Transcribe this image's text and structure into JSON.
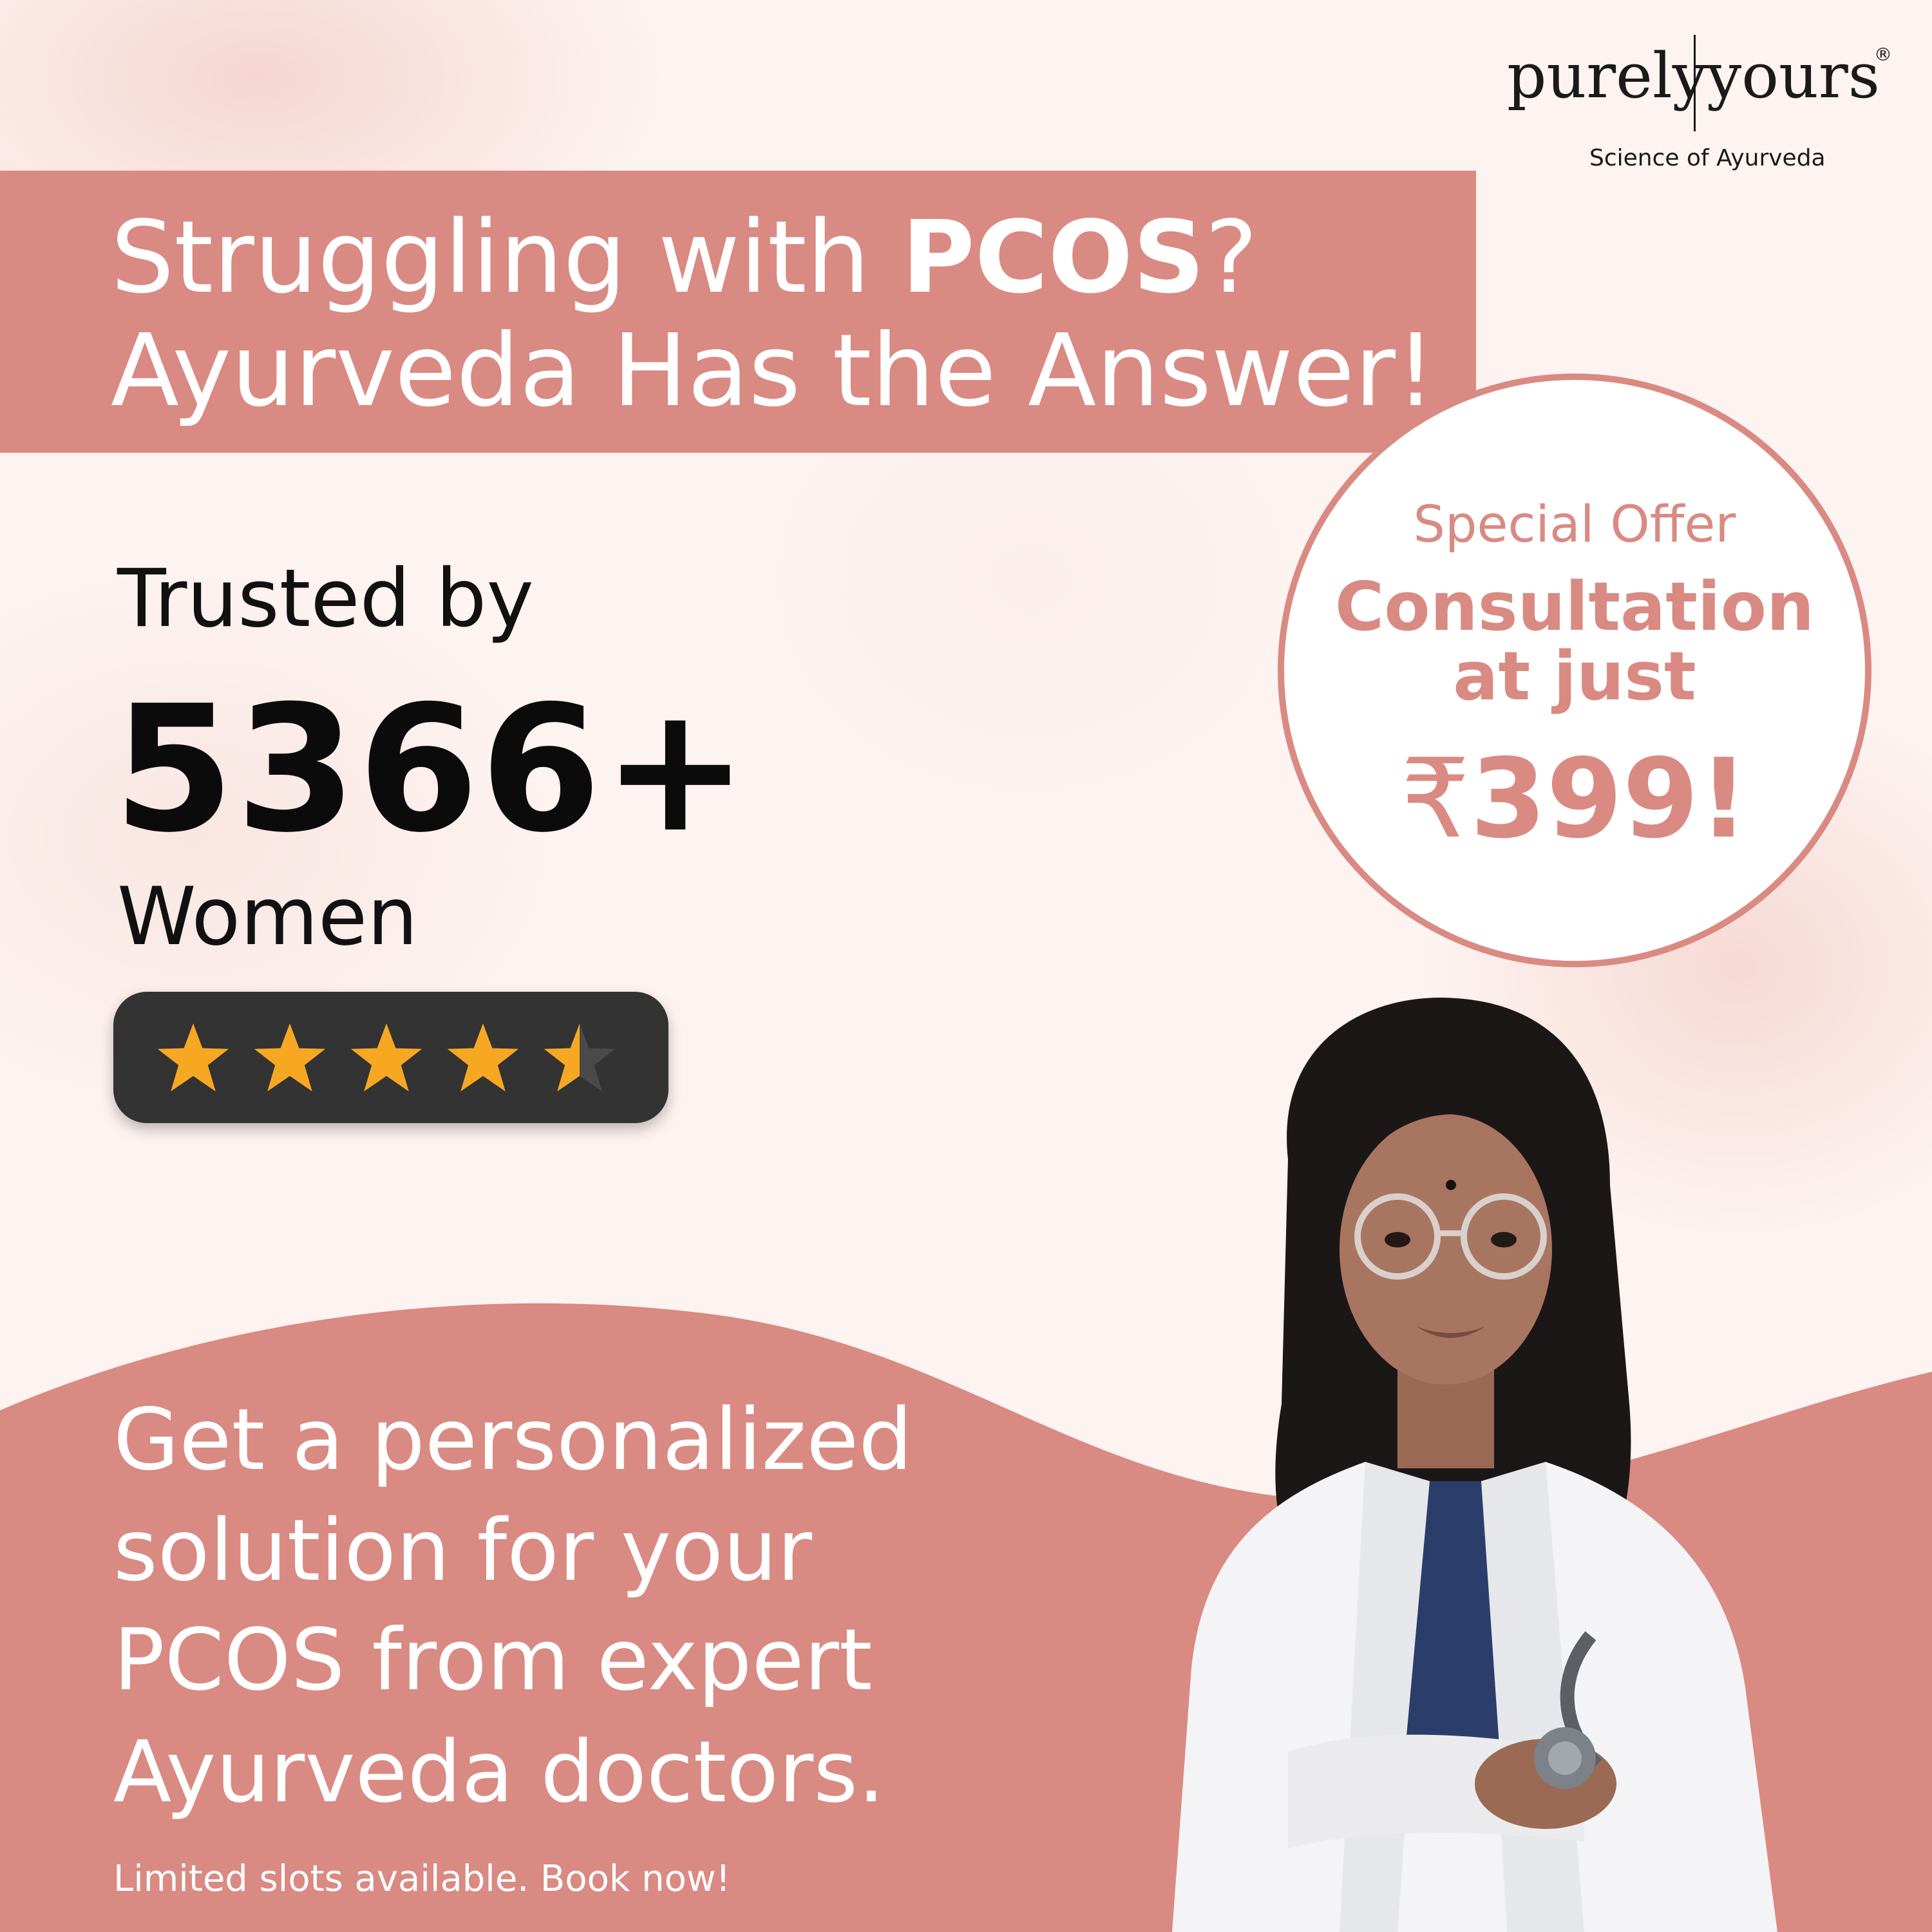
{
  "brand": {
    "word1": "purely",
    "word2": "yours",
    "registered": "®",
    "tagline": "Science of Ayurveda"
  },
  "headline": {
    "line1_prefix": "Struggling with ",
    "line1_bold": "PCOS",
    "line1_suffix": "?",
    "line2": "Ayurveda Has the Answer!"
  },
  "trust": {
    "label": "Trusted by",
    "count": "5366+",
    "noun": "Women"
  },
  "rating": {
    "stars_filled": 4.5,
    "stars_total": 5
  },
  "offer": {
    "label": "Special Offer",
    "line1": "Consultation",
    "line2": "at just",
    "currency": "₹",
    "price": "399!"
  },
  "body": {
    "line1": "Get a personalized",
    "line2": "solution for your",
    "line3": "PCOS from expert",
    "line4": "Ayurveda doctors."
  },
  "cta": "Limited slots available. Book now!",
  "colors": {
    "accent": "#d98a82",
    "text_dark": "#111111",
    "star": "#f7a823",
    "rating_bg": "#333333"
  },
  "icons": {
    "star": "star-icon",
    "doctor": "doctor-illustration"
  }
}
